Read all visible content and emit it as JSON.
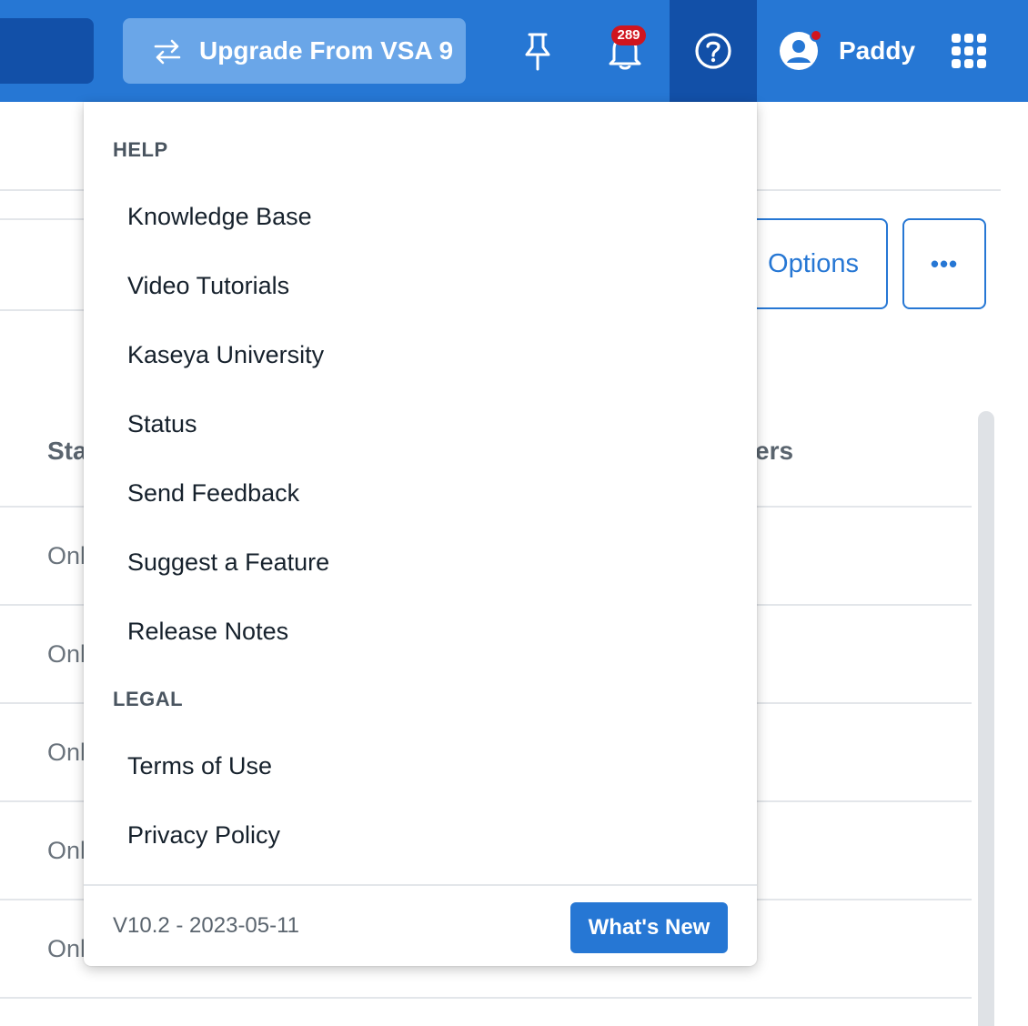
{
  "header": {
    "upgrade_label": "Upgrade From VSA 9",
    "notifications_count": "289",
    "user_name": "Paddy",
    "icons": [
      "swap-icon",
      "pin-icon",
      "bell-icon",
      "help-icon",
      "user-avatar-icon",
      "apps-grid-icon"
    ],
    "accent_color": "#2677d4",
    "active_color": "#1250a8",
    "badge_color": "#d0151e"
  },
  "page": {
    "options_label": "Options",
    "more_label": "•••",
    "col_header_left": "Sta",
    "col_header_right": "ers",
    "rows": [
      "Onl",
      "Onl",
      "Onl",
      "Onl",
      "Onl"
    ]
  },
  "help_menu": {
    "help_title": "HELP",
    "help_items": [
      "Knowledge Base",
      "Video Tutorials",
      "Kaseya University",
      "Status",
      "Send Feedback",
      "Suggest a Feature",
      "Release Notes"
    ],
    "legal_title": "LEGAL",
    "legal_items": [
      "Terms of Use",
      "Privacy Policy"
    ],
    "version": "V10.2 - 2023-05-11",
    "whats_new_label": "What's New"
  }
}
